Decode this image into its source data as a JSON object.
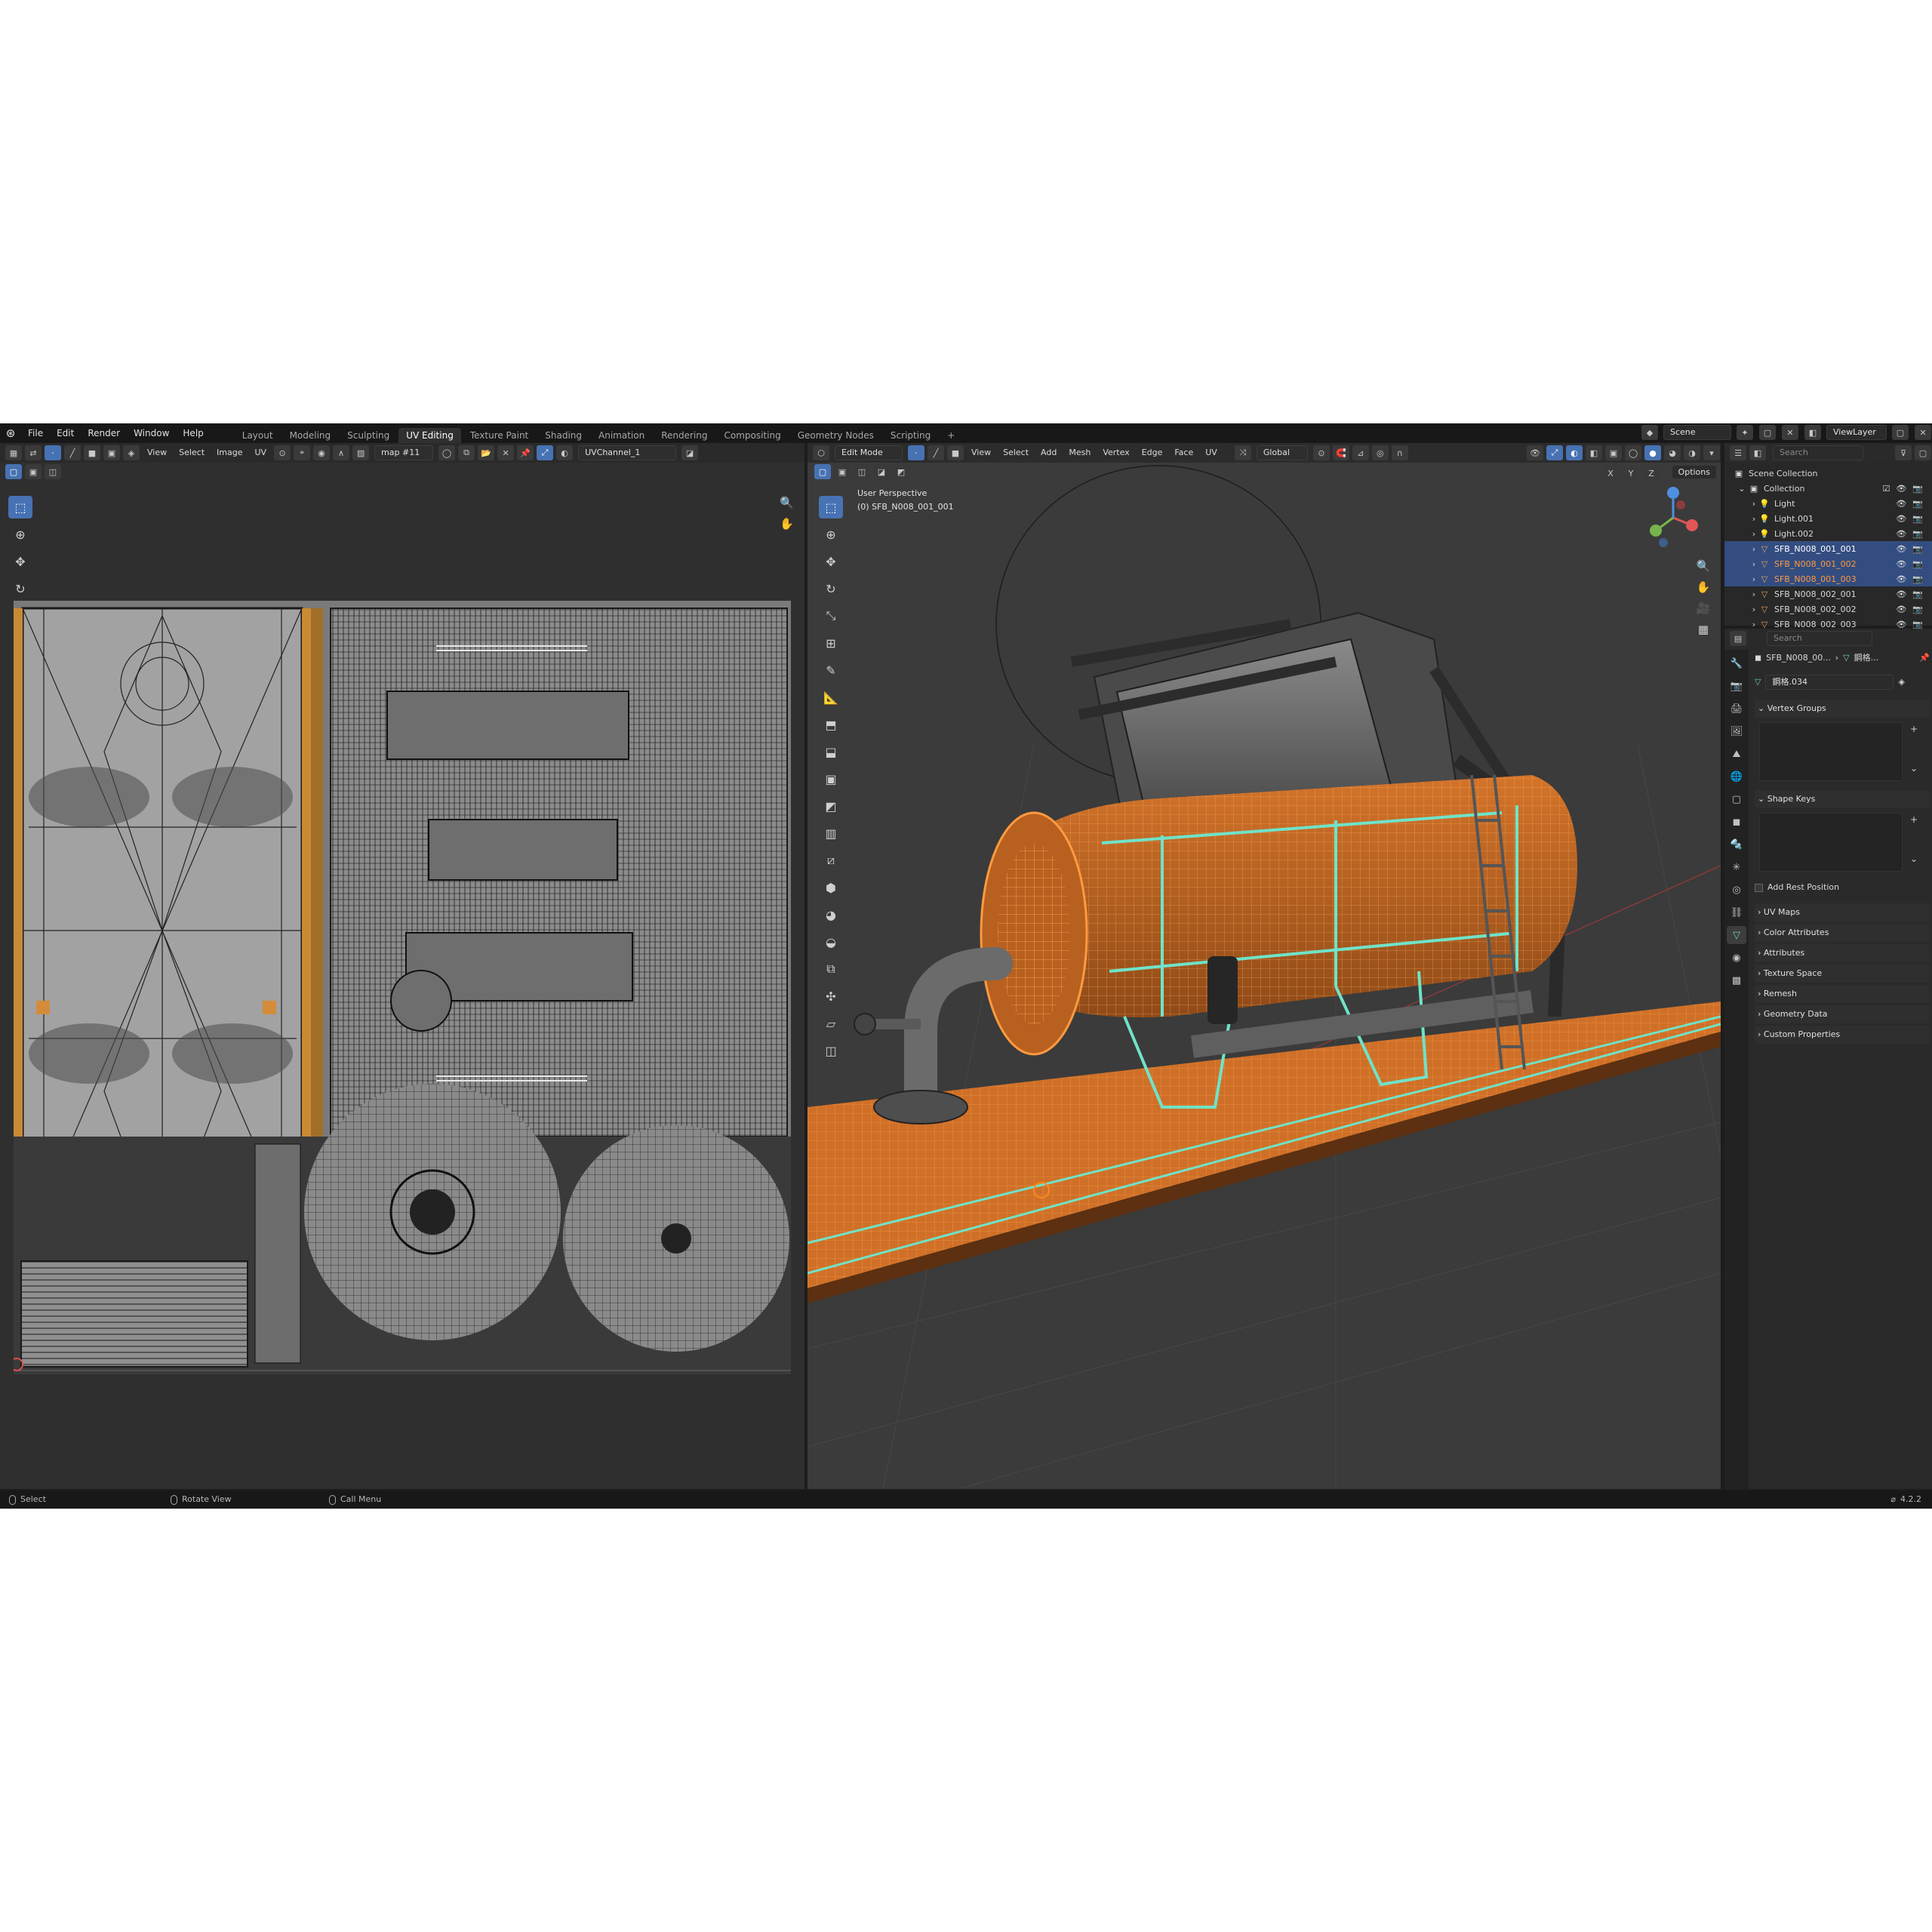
{
  "menu": [
    "File",
    "Edit",
    "Render",
    "Window",
    "Help"
  ],
  "workspaces": [
    {
      "label": "Layout",
      "active": false
    },
    {
      "label": "Modeling",
      "active": false
    },
    {
      "label": "Sculpting",
      "active": false
    },
    {
      "label": "UV Editing",
      "active": true
    },
    {
      "label": "Texture Paint",
      "active": false
    },
    {
      "label": "Shading",
      "active": false
    },
    {
      "label": "Animation",
      "active": false
    },
    {
      "label": "Rendering",
      "active": false
    },
    {
      "label": "Compositing",
      "active": false
    },
    {
      "label": "Geometry Nodes",
      "active": false
    },
    {
      "label": "Scripting",
      "active": false
    }
  ],
  "add_workspace": "+",
  "scene": "Scene",
  "view_layer": "ViewLayer",
  "uv_editor": {
    "menus": [
      "View",
      "Select",
      "Image",
      "UV"
    ],
    "image_name": "map #11",
    "uv_map": "UVChannel_1"
  },
  "viewport": {
    "mode": "Edit Mode",
    "menus": [
      "View",
      "Select",
      "Add",
      "Mesh",
      "Vertex",
      "Edge",
      "Face",
      "UV"
    ],
    "transform_orientation": "Global",
    "axes": [
      "X",
      "Y",
      "Z"
    ],
    "options": "Options",
    "info_line1": "User Perspective",
    "info_line2": "(0) SFB_N008_001_001"
  },
  "outliner": {
    "search_placeholder": "Search",
    "scene_collection": "Scene Collection",
    "collection": "Collection",
    "items": [
      {
        "name": "Light",
        "type": "light",
        "selected": false,
        "highlight": false
      },
      {
        "name": "Light.001",
        "type": "light",
        "selected": false,
        "highlight": false
      },
      {
        "name": "Light.002",
        "type": "light",
        "selected": false,
        "highlight": false
      },
      {
        "name": "SFB_N008_001_001",
        "type": "mesh",
        "selected": true,
        "highlight": true
      },
      {
        "name": "SFB_N008_001_002",
        "type": "mesh",
        "selected": true,
        "highlight": false
      },
      {
        "name": "SFB_N008_001_003",
        "type": "mesh",
        "selected": true,
        "highlight": false
      },
      {
        "name": "SFB_N008_002_001",
        "type": "mesh",
        "selected": false,
        "highlight": false
      },
      {
        "name": "SFB_N008_002_002",
        "type": "mesh",
        "selected": false,
        "highlight": false
      },
      {
        "name": "SFB_N008_002_003",
        "type": "mesh",
        "selected": false,
        "highlight": false
      }
    ]
  },
  "properties": {
    "search_placeholder": "Search",
    "breadcrumb_object": "SFB_N008_00...",
    "breadcrumb_data": "鋼格...",
    "mesh_name": "鋼格.034",
    "panels": {
      "vertex_groups": "Vertex Groups",
      "shape_keys": "Shape Keys",
      "add_rest_position": "Add Rest Position",
      "uv_maps": "UV Maps",
      "color_attributes": "Color Attributes",
      "attributes": "Attributes",
      "texture_space": "Texture Space",
      "remesh": "Remesh",
      "geometry_data": "Geometry Data",
      "custom_properties": "Custom Properties"
    }
  },
  "status": {
    "select": "Select",
    "rotate": "Rotate View",
    "call_menu": "Call Menu",
    "version": "4.2.2"
  },
  "colors": {
    "accent_blue": "#4772b3",
    "selection_orange": "#ff8a1c",
    "seam_cyan": "#6fe3c8",
    "outliner_selected": "#334d80"
  }
}
